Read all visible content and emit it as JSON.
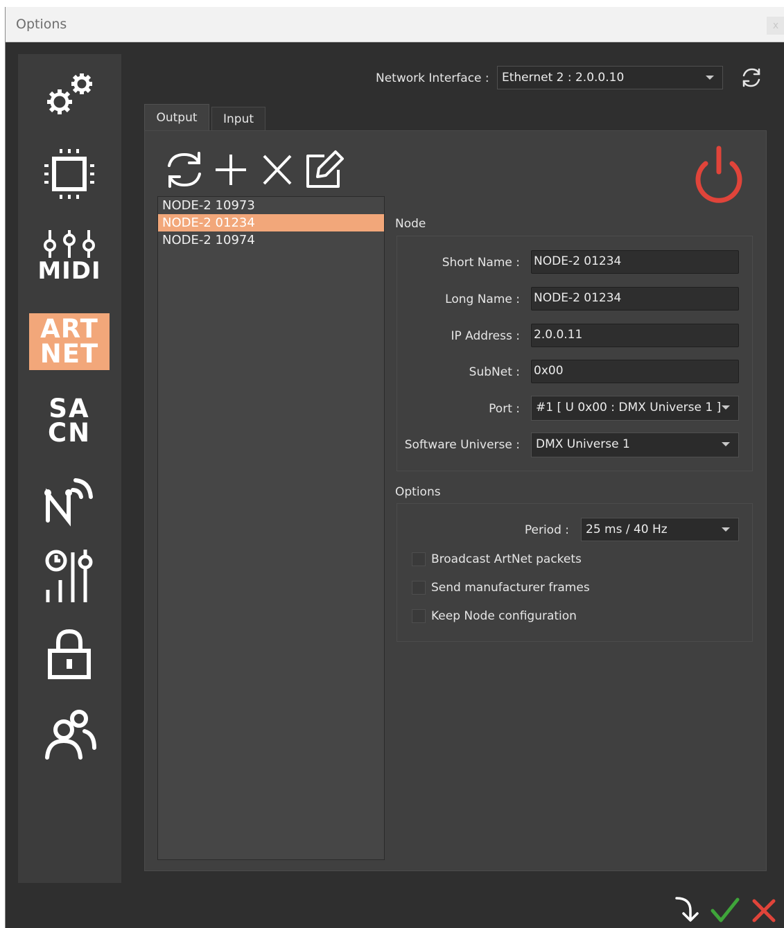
{
  "window": {
    "title": "Options",
    "close_label": "x"
  },
  "sidebar": {
    "items": [
      {
        "name": "general-settings",
        "icon": "gears-icon"
      },
      {
        "name": "hardware",
        "icon": "chip-icon"
      },
      {
        "name": "midi",
        "icon": "midi-faders-icon",
        "text": "MIDI"
      },
      {
        "name": "artnet",
        "icon": "artnet-logo",
        "text_line1": "ART",
        "text_line2": "NET",
        "active": true
      },
      {
        "name": "sacn",
        "icon": "sacn-logo",
        "text_line1": "SA",
        "text_line2": "CN"
      },
      {
        "name": "network",
        "icon": "network-wireless-icon"
      },
      {
        "name": "timecode",
        "icon": "timecode-faders-icon"
      },
      {
        "name": "security",
        "icon": "lock-icon"
      },
      {
        "name": "users",
        "icon": "users-icon"
      }
    ]
  },
  "network": {
    "label": "Network Interface :",
    "value": "Ethernet 2 : 2.0.0.10"
  },
  "tabs": [
    {
      "label": "Output",
      "selected": true
    },
    {
      "label": "Input",
      "selected": false
    }
  ],
  "node_list": {
    "items": [
      "NODE-2  10973",
      "NODE-2 01234",
      "NODE-2 10974"
    ],
    "selected_index": 1
  },
  "node": {
    "group_title": "Node",
    "short_name_label": "Short Name :",
    "short_name": "NODE-2 01234",
    "long_name_label": "Long Name :",
    "long_name": "NODE-2 01234",
    "ip_label": "IP Address :",
    "ip": "2.0.0.11",
    "subnet_label": "SubNet :",
    "subnet": "0x00",
    "port_label": "Port :",
    "port": "#1 [ U 0x00 : DMX Universe 1 ]",
    "universe_label": "Software Universe :",
    "universe": "DMX Universe 1"
  },
  "options": {
    "group_title": "Options",
    "period_label": "Period :",
    "period": "25 ms / 40 Hz",
    "checkboxes": [
      {
        "label": "Broadcast ArtNet packets",
        "checked": false
      },
      {
        "label": "Send manufacturer frames",
        "checked": false
      },
      {
        "label": "Keep Node configuration",
        "checked": false
      }
    ]
  },
  "colors": {
    "accent": "#f2a77a",
    "power": "#e0443a",
    "ok": "#3fa53a",
    "cancel": "#e0443a"
  }
}
